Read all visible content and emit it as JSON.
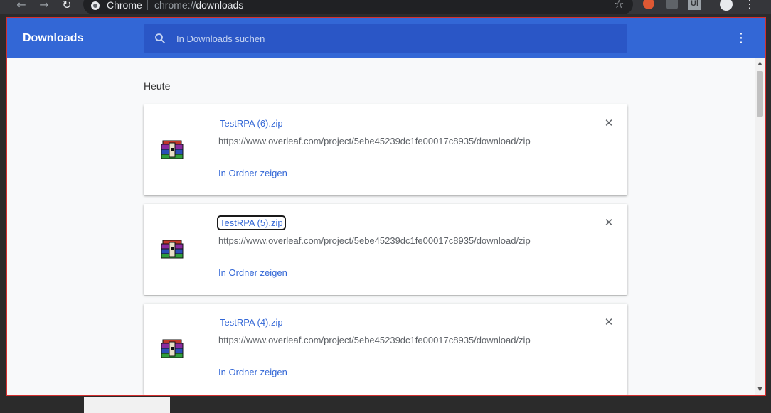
{
  "browser": {
    "app_label": "Chrome",
    "url_scheme": "chrome://",
    "url_path": "downloads",
    "extension_label": "Ui"
  },
  "toolbar": {
    "title": "Downloads",
    "search_placeholder": "In Downloads suchen"
  },
  "section": {
    "heading": "Heute"
  },
  "downloads": [
    {
      "filename": "TestRPA (6).zip",
      "url": "https://www.overleaf.com/project/5ebe45239dc1fe00017c8935/download/zip",
      "action": "In Ordner zeigen"
    },
    {
      "filename": "TestRPA (5).zip",
      "url": "https://www.overleaf.com/project/5ebe45239dc1fe00017c8935/download/zip",
      "action": "In Ordner zeigen"
    },
    {
      "filename": "TestRPA (4).zip",
      "url": "https://www.overleaf.com/project/5ebe45239dc1fe00017c8935/download/zip",
      "action": "In Ordner zeigen"
    }
  ],
  "colors": {
    "toolbar": "#3367d6",
    "search_bg": "#2a56c6",
    "link": "#3367d6",
    "frame_highlight": "#d32f2f"
  }
}
